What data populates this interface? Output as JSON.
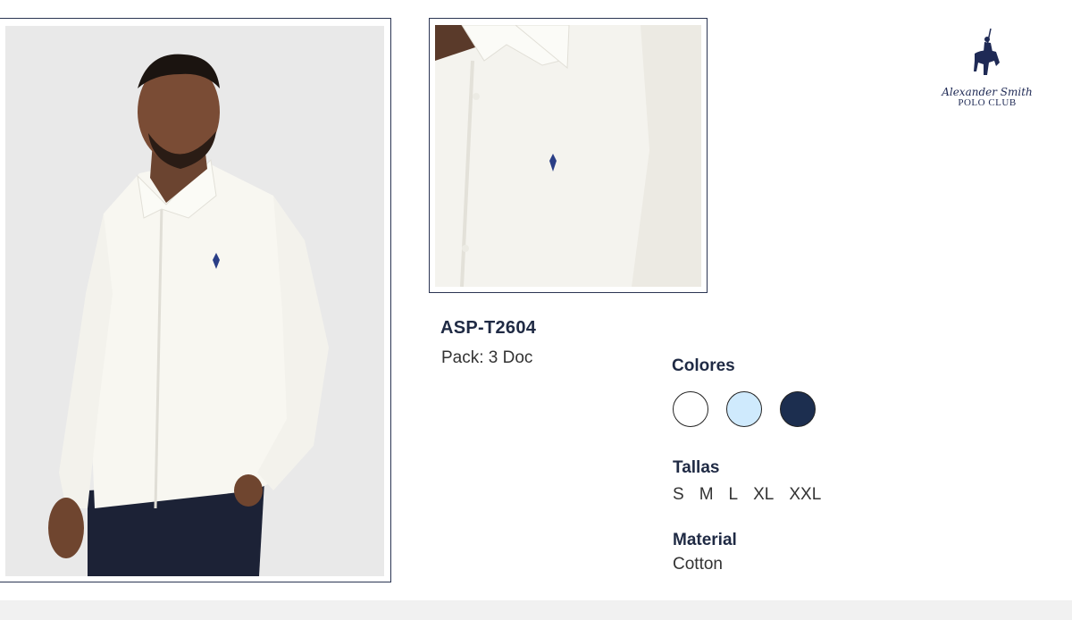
{
  "product": {
    "sku": "ASP-T2604",
    "pack": "Pack: 3 Doc"
  },
  "colors": {
    "title": "Colores",
    "swatches": [
      {
        "name": "white",
        "hex": "#ffffff"
      },
      {
        "name": "light-blue",
        "hex": "#cfeafd"
      },
      {
        "name": "navy",
        "hex": "#1c2e4f"
      }
    ]
  },
  "sizes": {
    "title": "Tallas",
    "items": [
      "S",
      "M",
      "L",
      "XL",
      "XXL"
    ]
  },
  "material": {
    "title": "Material",
    "value": "Cotton"
  },
  "logo": {
    "script": "Alexander Smith",
    "sub": "POLO CLUB"
  },
  "images": {
    "main": "model-wearing-white-shirt-photo",
    "detail": "shirt-collar-detail-photo"
  }
}
